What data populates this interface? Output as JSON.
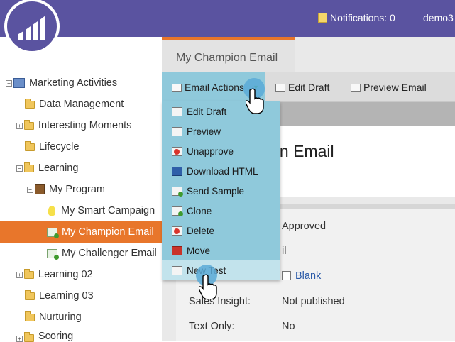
{
  "header": {
    "notifications_label": "Notifications: 0",
    "user_label": "demo3",
    "colors": {
      "bar": "#5a53a0",
      "accent": "#e8762b"
    }
  },
  "sidebar": {
    "items": [
      {
        "label": "Marketing Activities",
        "icon": "marketing-activities-icon",
        "expander": "minus"
      },
      {
        "label": "Data Management",
        "icon": "folder-icon",
        "expander": ""
      },
      {
        "label": "Interesting Moments",
        "icon": "folder-icon",
        "expander": "plus"
      },
      {
        "label": "Lifecycle",
        "icon": "folder-icon",
        "expander": ""
      },
      {
        "label": "Learning",
        "icon": "folder-icon",
        "expander": "minus"
      },
      {
        "label": "My Program",
        "icon": "program-icon",
        "expander": "minus"
      },
      {
        "label": "My Smart Campaign",
        "icon": "smart-campaign-icon",
        "expander": ""
      },
      {
        "label": "My Champion Email",
        "icon": "email-icon",
        "expander": "",
        "selected": true
      },
      {
        "label": "My Challenger Email",
        "icon": "email-icon",
        "expander": ""
      },
      {
        "label": "Learning 02",
        "icon": "folder-icon",
        "expander": "plus"
      },
      {
        "label": "Learning 03",
        "icon": "folder-icon",
        "expander": ""
      },
      {
        "label": "Nurturing",
        "icon": "folder-icon",
        "expander": ""
      },
      {
        "label": "Scoring",
        "icon": "folder-icon",
        "expander": "plus"
      }
    ]
  },
  "main": {
    "tab_label": "My Champion Email",
    "toolbar": {
      "email_actions": "Email Actions",
      "edit_draft": "Edit Draft",
      "preview_email": "Preview Email"
    },
    "title_partial": "ion Email",
    "properties": {
      "status_value": "Approved",
      "type_value_partial": "il",
      "template_value": "Blank",
      "sales_insight_label": "Sales Insight:",
      "sales_insight_value": "Not published",
      "text_only_label": "Text Only:",
      "text_only_value": "No"
    }
  },
  "menu": {
    "items": [
      {
        "label": "Edit Draft",
        "icon": "edit-draft-icon"
      },
      {
        "label": "Preview",
        "icon": "preview-icon"
      },
      {
        "label": "Unapprove",
        "icon": "unapprove-icon"
      },
      {
        "label": "Download HTML",
        "icon": "download-html-icon"
      },
      {
        "label": "Send Sample",
        "icon": "send-sample-icon"
      },
      {
        "label": "Clone",
        "icon": "clone-icon"
      },
      {
        "label": "Delete",
        "icon": "delete-icon"
      },
      {
        "label": "Move",
        "icon": "move-icon"
      },
      {
        "label": "New Test",
        "icon": "new-test-icon",
        "hover": true
      }
    ]
  },
  "annotations": {
    "step1": "1",
    "step2": "2"
  }
}
